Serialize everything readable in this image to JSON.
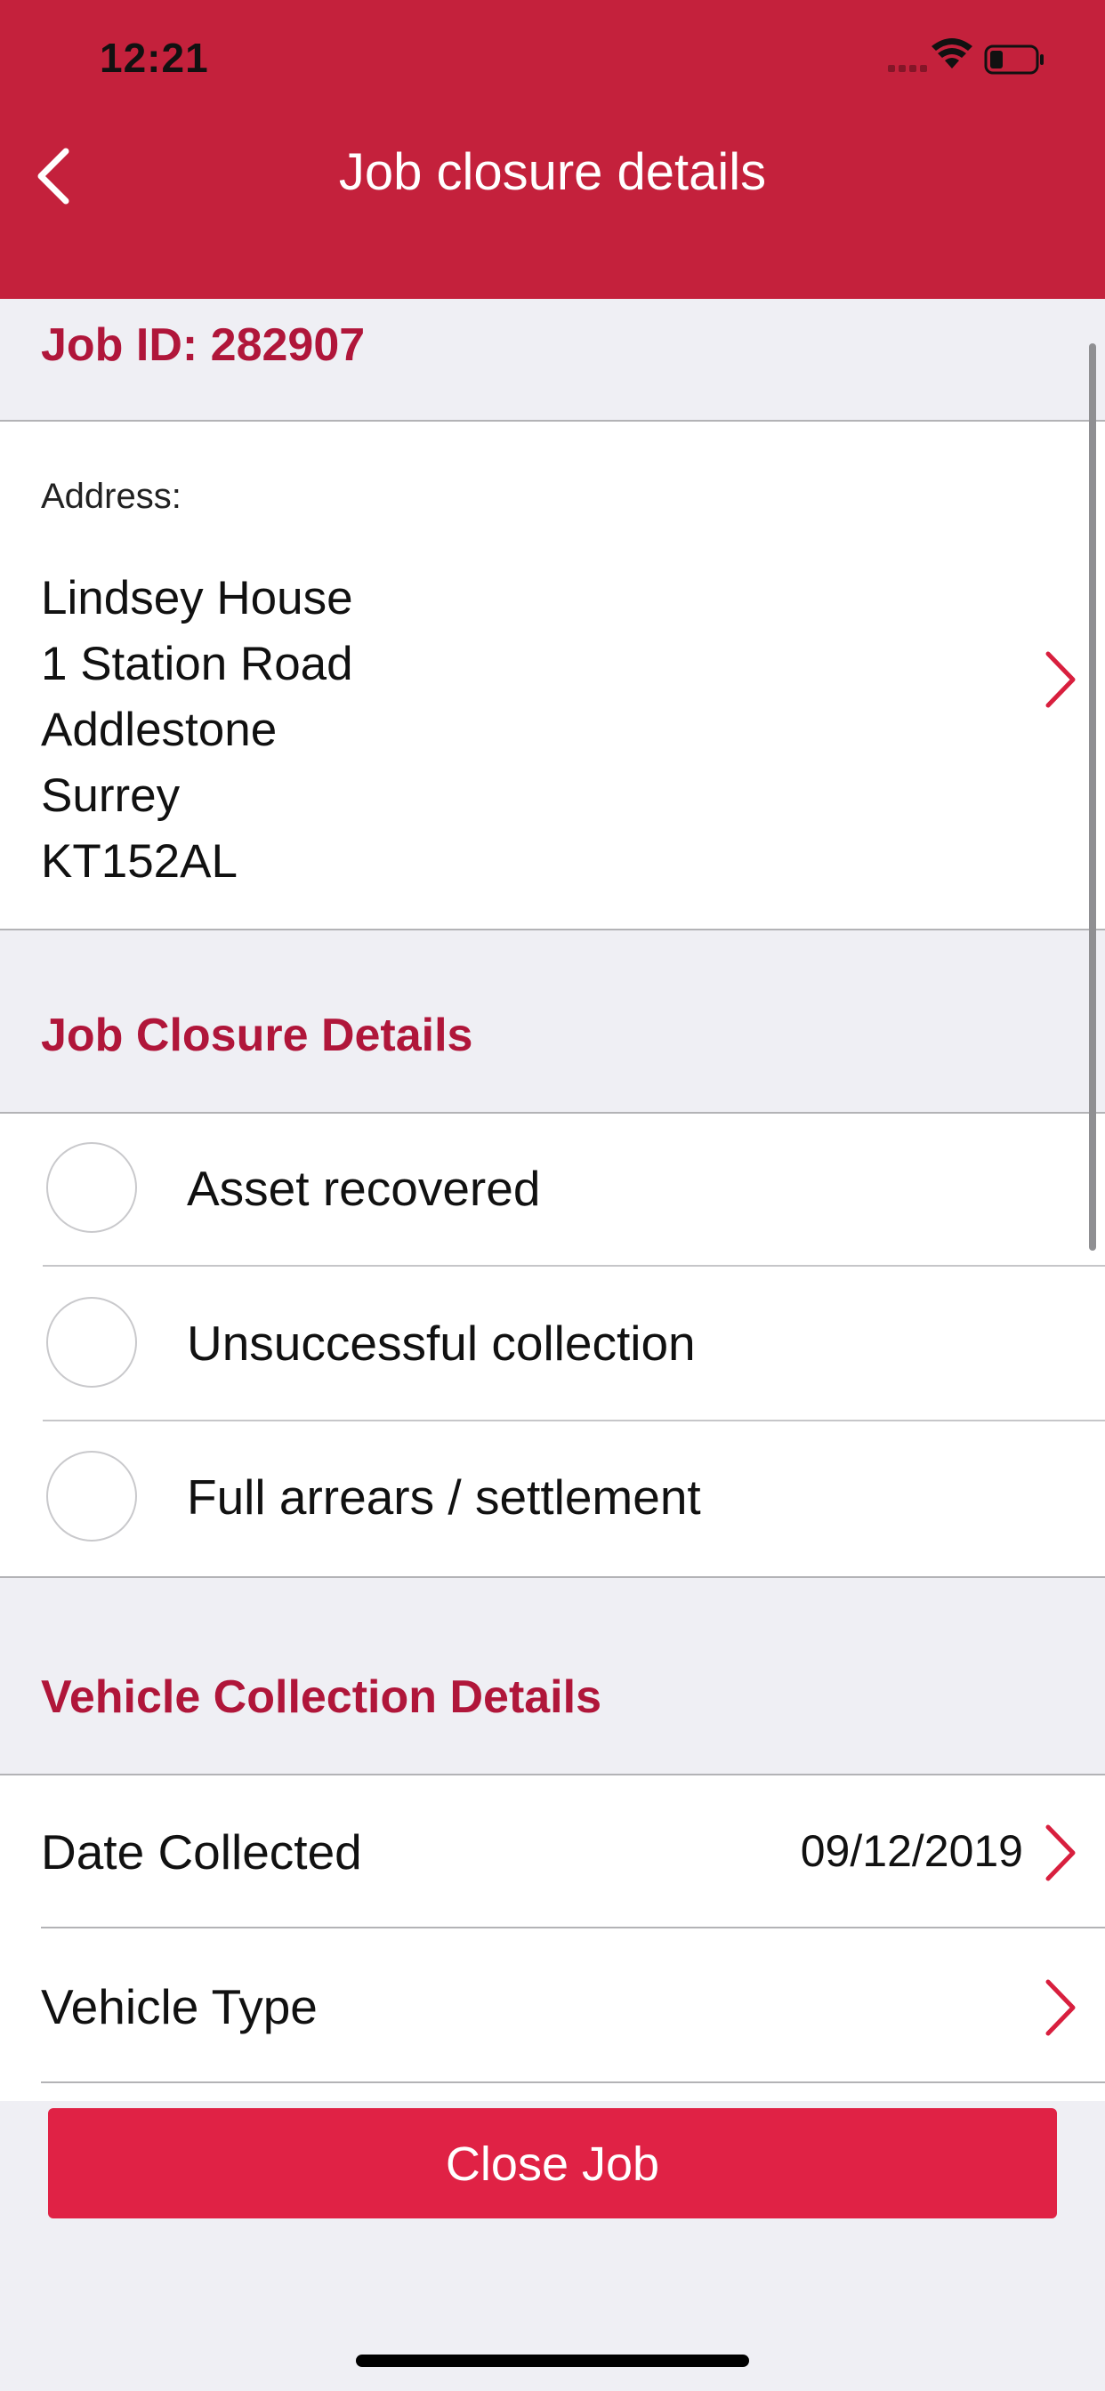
{
  "status_bar": {
    "time": "12:21"
  },
  "nav": {
    "title": "Job closure details",
    "back_icon": "chevron-left-icon"
  },
  "job": {
    "id_text": "Job ID: 282907"
  },
  "address": {
    "label": "Address:",
    "lines": [
      "Lindsey House",
      "1 Station Road",
      "Addlestone",
      "Surrey",
      "KT152AL"
    ]
  },
  "closure": {
    "heading": "Job Closure Details",
    "options": [
      {
        "label": "Asset recovered",
        "selected": false
      },
      {
        "label": "Unsuccessful collection",
        "selected": false
      },
      {
        "label": "Full arrears / settlement",
        "selected": false
      }
    ]
  },
  "vehicle": {
    "heading": "Vehicle Collection Details",
    "rows": [
      {
        "label": "Date Collected",
        "value": "09/12/2019"
      },
      {
        "label": "Vehicle Type",
        "value": ""
      }
    ]
  },
  "actions": {
    "close_job": "Close Job"
  },
  "colors": {
    "brand": "#c4213c",
    "accent_text": "#b0163a",
    "button": "#e02245",
    "background": "#efeff4"
  }
}
